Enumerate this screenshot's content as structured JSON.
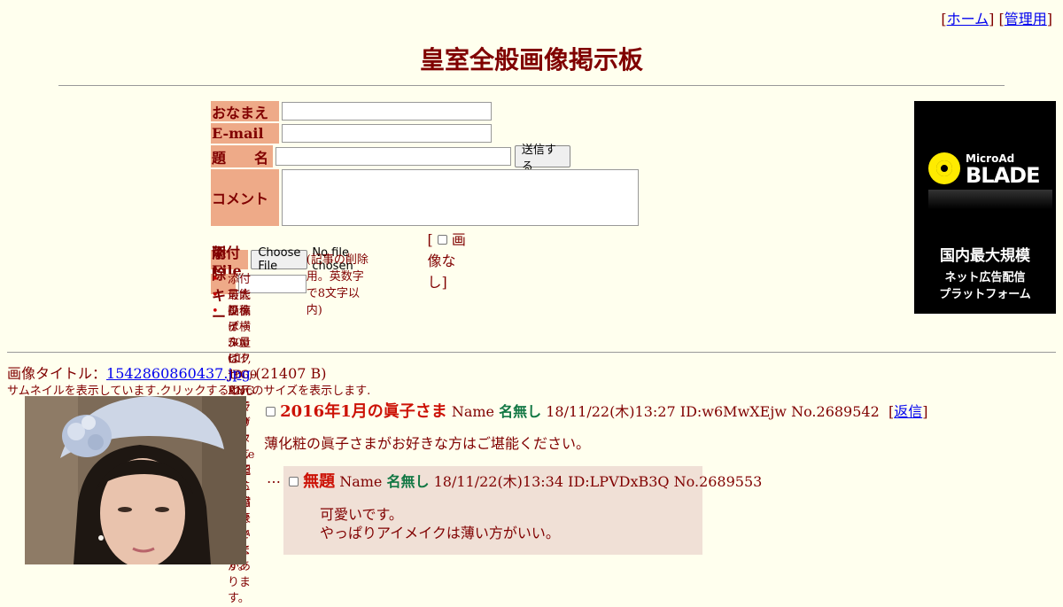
{
  "top_links": {
    "home": "ホーム",
    "admin": "管理用"
  },
  "title": "皇室全般画像掲示板",
  "form": {
    "name_label": "おなまえ",
    "email_label": "E-mail",
    "subject_label": "題　　名",
    "submit_label": "送信する",
    "comment_label": "コメント",
    "file_label": "添付File",
    "choose_file": "Choose File",
    "no_file": "No file chosen",
    "no_image_label": "画像なし",
    "delete_key_label": "削除キー",
    "delete_key_note": "(記事の削除用。英数字で8文字以内)",
    "notes": [
      "添付可能ファイル：GIF, JPG, PNG ブラウザによっては正常に添付できないことがあります。",
      "最大投稿データ量は 1000 KB までです。sage機能付き。",
      "画像は横 500ピクセル、縦 500ピクセルを超えると縮小表示されます。"
    ]
  },
  "ad": {
    "brand_small": "MicroAd",
    "brand_large": "BLADE",
    "line1": "国内最大規模",
    "line2": "ネット広告配信",
    "line3": "プラットフォーム"
  },
  "thread": {
    "image_title_prefix": "画像タイトル：",
    "image_file": "1542860860437.jpg",
    "image_size": "-(21407 B)",
    "thumb_note": "サムネイルを表示しています.クリックすると元のサイズを表示します.",
    "op": {
      "subject": "2016年1月の眞子さま",
      "name_prefix": "Name",
      "name": "名無し",
      "datetime": "18/11/22(木)13:27",
      "id": "ID:w6MwXEjw",
      "no": "No.2689542",
      "reply_link": "返信",
      "body": "薄化粧の眞子さまがお好きな方はご堪能ください。"
    },
    "reply": {
      "subject": "無題",
      "name_prefix": "Name",
      "name": "名無し",
      "datetime": "18/11/22(木)13:34",
      "id": "ID:LPVDxB3Q",
      "no": "No.2689553",
      "lines": [
        "可愛いです。",
        "やっぱりアイメイクは薄い方がいい。"
      ]
    }
  }
}
